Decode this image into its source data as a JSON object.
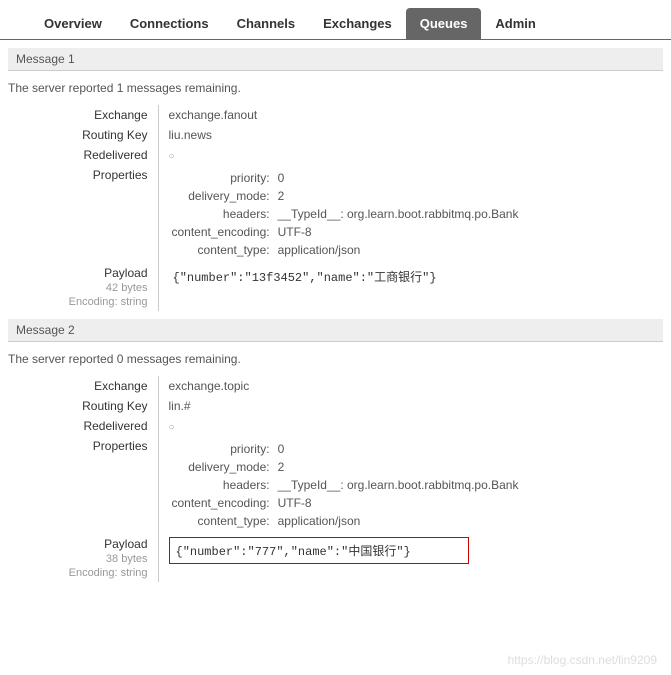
{
  "tabs": {
    "overview": "Overview",
    "connections": "Connections",
    "channels": "Channels",
    "exchanges": "Exchanges",
    "queues": "Queues",
    "admin": "Admin",
    "active": "queues"
  },
  "labels": {
    "exchange": "Exchange",
    "routing_key": "Routing Key",
    "redelivered": "Redelivered",
    "properties": "Properties",
    "payload": "Payload",
    "encoding_prefix": "Encoding: ",
    "priority": "priority:",
    "delivery_mode": "delivery_mode:",
    "headers": "headers:",
    "content_encoding": "content_encoding:",
    "content_type": "content_type:",
    "type_id": "__TypeId__:",
    "remaining_prefix": "The server reported ",
    "remaining_suffix": " messages remaining."
  },
  "messages": [
    {
      "title": "Message 1",
      "remaining": "1",
      "exchange": "exchange.fanout",
      "routing_key": "liu.news",
      "redelivered": "○",
      "priority": "0",
      "delivery_mode": "2",
      "type_id_value": "org.learn.boot.rabbitmq.po.Bank",
      "content_encoding": "UTF-8",
      "content_type": "application/json",
      "payload_size": "42 bytes",
      "encoding": "string",
      "payload": "{\"number\":\"13f3452\",\"name\":\"工商银行\"}",
      "highlight": false
    },
    {
      "title": "Message 2",
      "remaining": "0",
      "exchange": "exchange.topic",
      "routing_key": "lin.#",
      "redelivered": "○",
      "priority": "0",
      "delivery_mode": "2",
      "type_id_value": "org.learn.boot.rabbitmq.po.Bank",
      "content_encoding": "UTF-8",
      "content_type": "application/json",
      "payload_size": "38 bytes",
      "encoding": "string",
      "payload": "{\"number\":\"777\",\"name\":\"中国银行\"}",
      "highlight": true
    }
  ],
  "watermark": "https://blog.csdn.net/lin9209"
}
